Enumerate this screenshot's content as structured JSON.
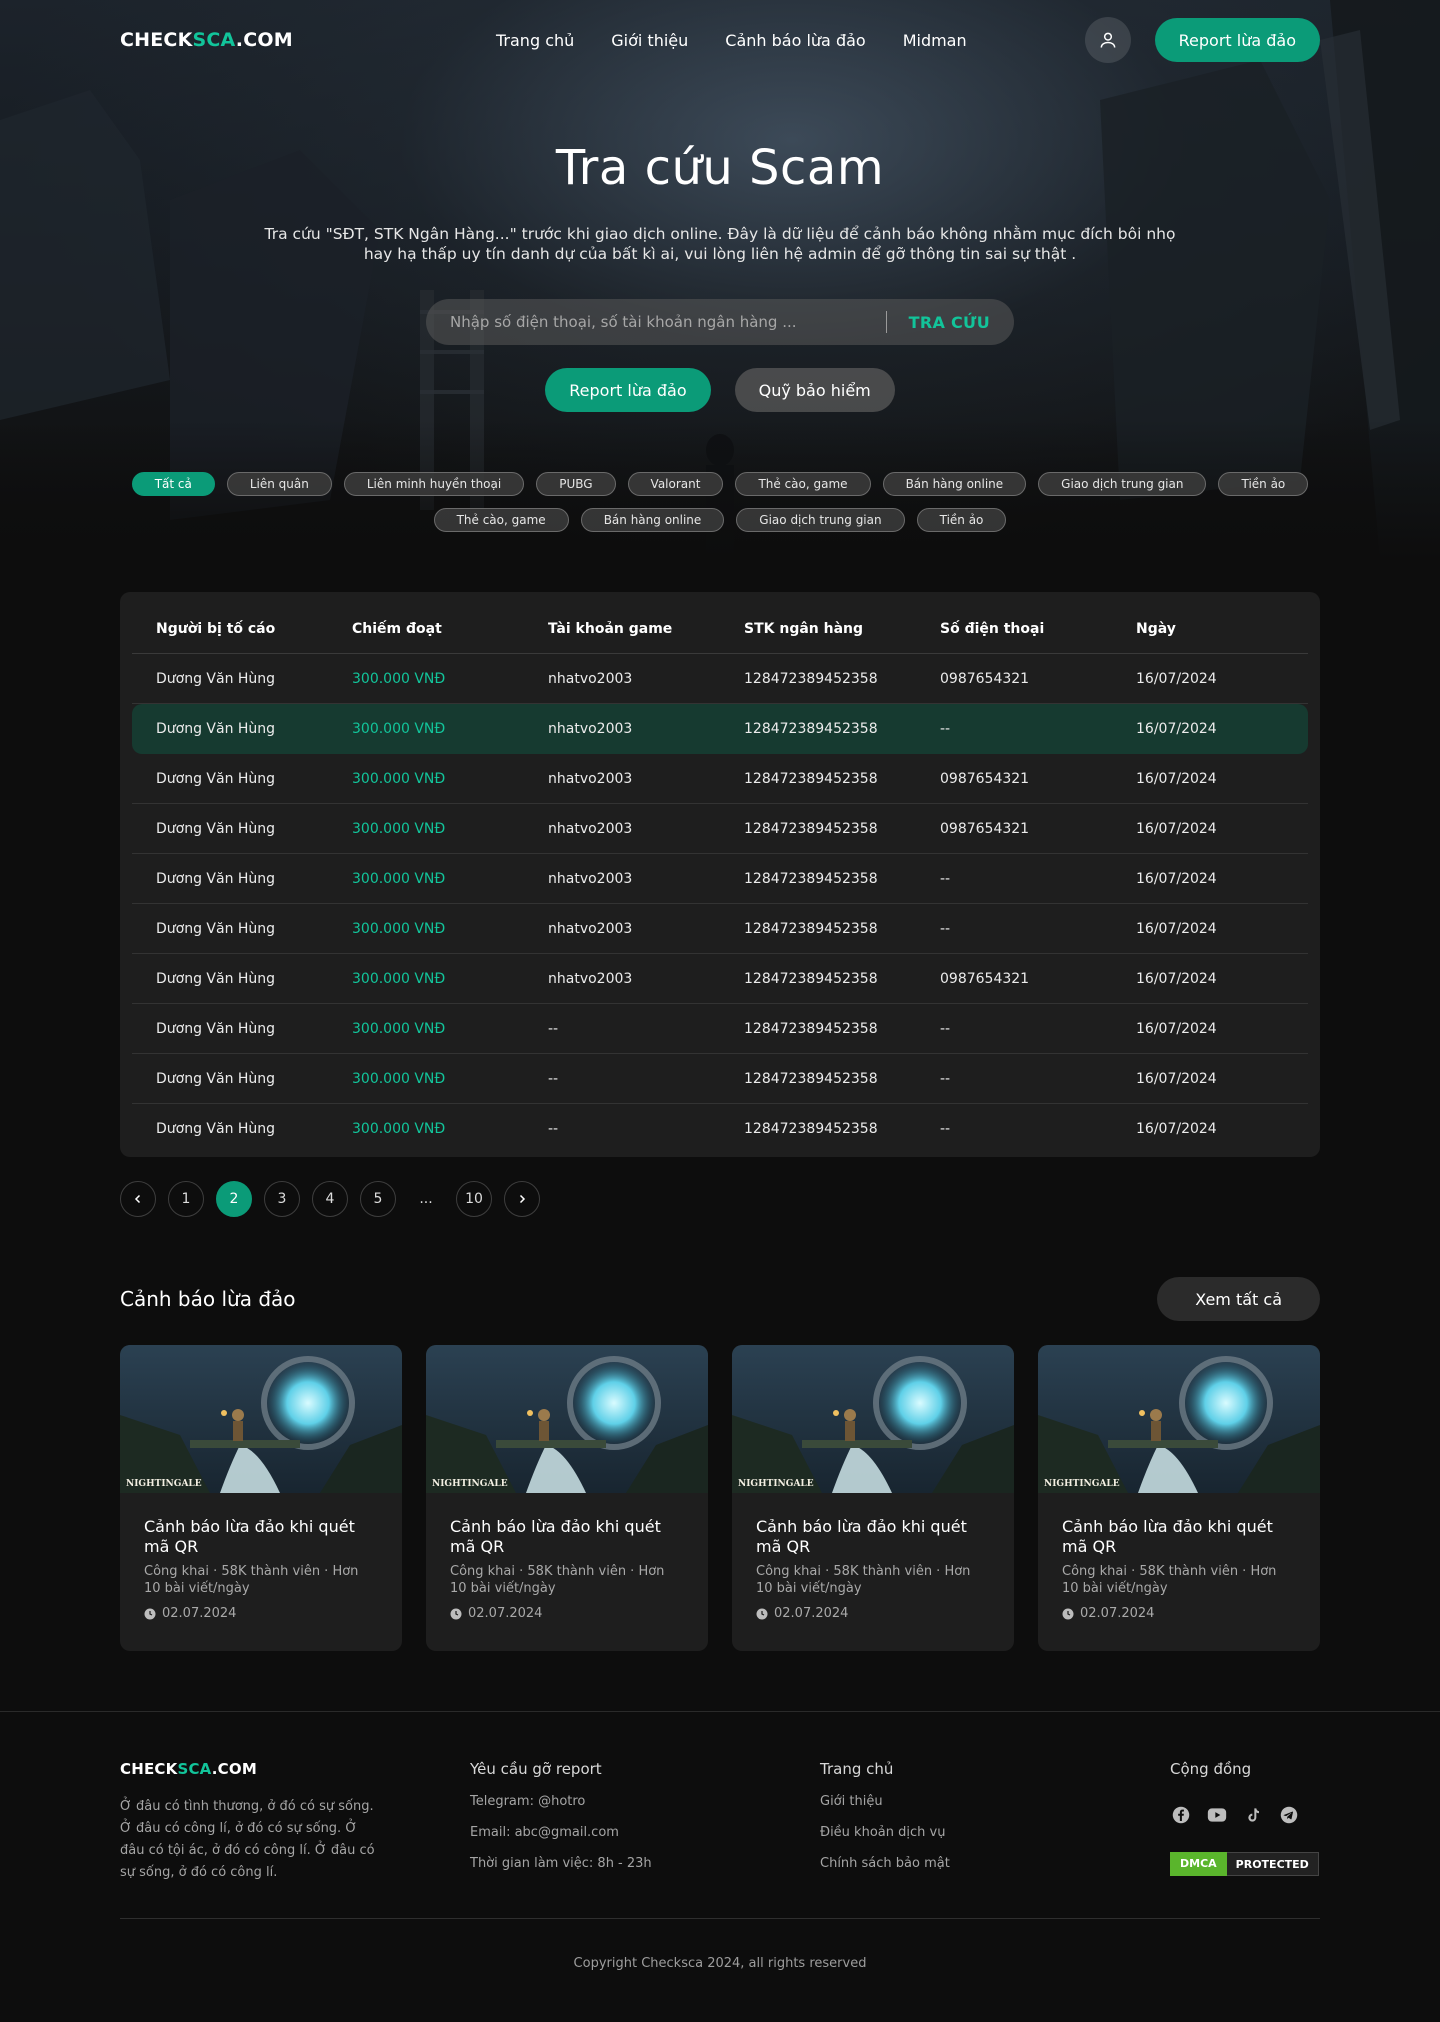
{
  "brand": {
    "logo_part1": "CHECK",
    "logo_part2": "SCA",
    "logo_part3": ".COM",
    "accent_color": "#12c49a",
    "button_color": "#0b9b78"
  },
  "nav": {
    "links": [
      "Trang chủ",
      "Giới thiệu",
      "Cảnh báo lừa đảo",
      "Midman"
    ],
    "user_icon": "user-icon",
    "report_label": "Report lừa đảo"
  },
  "hero": {
    "title": "Tra cứu Scam",
    "description": "Tra cứu \"SĐT, STK Ngân Hàng...\" trước khi giao dịch online. Đây là dữ liệu để cảnh báo không nhằm mục đích bôi nhọ hay hạ thấp uy tín danh dự của bất kì ai, vui lòng liên hệ admin để gỡ thông tin sai sự thật .",
    "search_placeholder": "Nhập số điện thoại, số tài khoản ngân hàng ...",
    "search_button": "TRA CỨU",
    "report_button": "Report lừa đảo",
    "insurance_button": "Quỹ bảo hiểm"
  },
  "tags": {
    "row1": [
      "Tất cả",
      "Liên quân",
      "Liên minh huyền thoại",
      "PUBG",
      "Valorant",
      "Thẻ cào, game",
      "Bán hàng online",
      "Giao dịch trung gian",
      "Tiền ảo"
    ],
    "row2": [
      "Thẻ cào, game",
      "Bán hàng online",
      "Giao dịch trung gian",
      "Tiền ảo"
    ],
    "active": "Tất cả"
  },
  "table": {
    "headers": [
      "Người bị tố cáo",
      "Chiếm đoạt",
      "Tài khoản game",
      "STK ngân hàng",
      "Số điện thoại",
      "Ngày"
    ],
    "rows": [
      [
        "Dương Văn Hùng",
        "300.000 VNĐ",
        "nhatvo2003",
        "128472389452358",
        "0987654321",
        "16/07/2024"
      ],
      [
        "Dương Văn Hùng",
        "300.000 VNĐ",
        "nhatvo2003",
        "128472389452358",
        "--",
        "16/07/2024"
      ],
      [
        "Dương Văn Hùng",
        "300.000 VNĐ",
        "nhatvo2003",
        "128472389452358",
        "0987654321",
        "16/07/2024"
      ],
      [
        "Dương Văn Hùng",
        "300.000 VNĐ",
        "nhatvo2003",
        "128472389452358",
        "0987654321",
        "16/07/2024"
      ],
      [
        "Dương Văn Hùng",
        "300.000 VNĐ",
        "nhatvo2003",
        "128472389452358",
        "--",
        "16/07/2024"
      ],
      [
        "Dương Văn Hùng",
        "300.000 VNĐ",
        "nhatvo2003",
        "128472389452358",
        "--",
        "16/07/2024"
      ],
      [
        "Dương Văn Hùng",
        "300.000 VNĐ",
        "nhatvo2003",
        "128472389452358",
        "0987654321",
        "16/07/2024"
      ],
      [
        "Dương Văn Hùng",
        "300.000 VNĐ",
        "--",
        "128472389452358",
        "--",
        "16/07/2024"
      ],
      [
        "Dương Văn Hùng",
        "300.000 VNĐ",
        "--",
        "128472389452358",
        "--",
        "16/07/2024"
      ],
      [
        "Dương Văn Hùng",
        "300.000 VNĐ",
        "--",
        "128472389452358",
        "--",
        "16/07/2024"
      ]
    ],
    "highlighted_row": 2
  },
  "pagination": {
    "pages": [
      "1",
      "2",
      "3",
      "4",
      "5",
      "...",
      "10"
    ],
    "current": "2",
    "prev_icon": "chevron-left-icon",
    "next_icon": "chevron-right-icon"
  },
  "warnings": {
    "title": "Cảnh báo lừa đảo",
    "view_all": "Xem tất cả",
    "cards": [
      {
        "image_label": "NIGHTINGALE",
        "title": "Cảnh báo lừa đảo khi quét mã QR",
        "meta": "Công khai · 58K thành viên · Hơn 10 bài viết/ngày",
        "date": "02.07.2024"
      },
      {
        "image_label": "NIGHTINGALE",
        "title": "Cảnh báo lừa đảo khi quét mã QR",
        "meta": "Công khai · 58K thành viên · Hơn 10 bài viết/ngày",
        "date": "02.07.2024"
      },
      {
        "image_label": "NIGHTINGALE",
        "title": "Cảnh báo lừa đảo khi quét mã QR",
        "meta": "Công khai · 58K thành viên · Hơn 10 bài viết/ngày",
        "date": "02.07.2024"
      },
      {
        "image_label": "NIGHTINGALE",
        "title": "Cảnh báo lừa đảo khi quét mã QR",
        "meta": "Công khai · 58K thành viên · Hơn 10 bài viết/ngày",
        "date": "02.07.2024"
      }
    ]
  },
  "footer": {
    "about": "Ở đâu có tình thương, ở đó có sự sống. Ở đâu có công lí, ở đó có sự sống. Ở đâu có tội ác, ở đó có công lí. Ở đâu có sự sống, ở đó có công lí.",
    "contact_title": "Yêu cầu gỡ report",
    "contact_items": [
      "Telegram: @hotro",
      "Email: abc@gmail.com",
      "Thời gian làm việc: 8h - 23h"
    ],
    "links_title": "Trang chủ",
    "links": [
      "Giới thiệu",
      "Điều khoản dịch vụ",
      "Chính sách bảo mật"
    ],
    "community_title": "Cộng đồng",
    "social_icons": [
      "facebook-icon",
      "youtube-icon",
      "tiktok-icon",
      "telegram-icon"
    ],
    "dmca_left": "DMCA",
    "dmca_right": "PROTECTED",
    "copyright": "Copyright Checksca 2024, all rights reserved"
  }
}
